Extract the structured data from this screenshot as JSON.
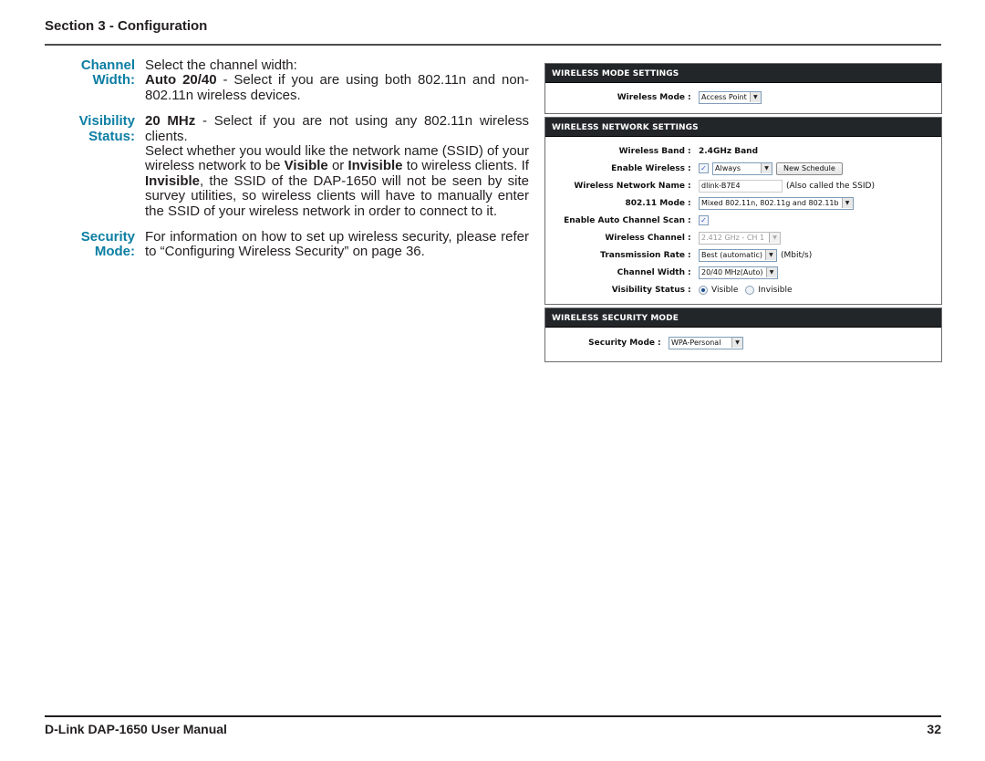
{
  "header": {
    "section_title": "Section 3 - Configuration"
  },
  "descriptions": [
    {
      "label_line1": "Channel",
      "label_line2": "Width:",
      "intro": "Select the channel width:",
      "bold1": "Auto 20/40",
      "text1": " - Select if you are using both 802.11n and non-802.11n wireless devices.",
      "bold2": "20 MHz",
      "text2": " - Select if you are not using any 802.11n wireless clients."
    },
    {
      "label_line1": "Visibility",
      "label_line2": "Status:",
      "text_a": "Select whether you would like the network name (SSID) of your wireless network to be ",
      "bold_a": "Visible",
      "text_b": " or ",
      "bold_b": "Invisible",
      "text_c": " to wireless clients. If ",
      "bold_c": "Invisible",
      "text_d": ", the SSID of the DAP-1650 will not be seen by site survey utilities, so wireless clients will have to manually enter the SSID of your wireless network in order to connect to it."
    },
    {
      "label_line1": "Security",
      "label_line2": "Mode:",
      "text": "For information on how to set up wireless security, please refer to “Configuring Wireless Security” on page 36."
    }
  ],
  "panels": {
    "mode": {
      "title": "WIRELESS MODE SETTINGS",
      "wireless_mode_label": "Wireless Mode",
      "wireless_mode_value": "Access Point"
    },
    "network": {
      "title": "WIRELESS NETWORK SETTINGS",
      "band_label": "Wireless Band",
      "band_value": "2.4GHz Band",
      "enable_label": "Enable Wireless",
      "enable_checked": true,
      "schedule_value": "Always",
      "new_schedule_button": "New Schedule",
      "ssid_label": "Wireless Network Name",
      "ssid_value": "dlink-B7E4",
      "ssid_note": "(Also called the SSID)",
      "mode_label": "802.11 Mode",
      "mode_value": "Mixed 802.11n, 802.11g and 802.11b",
      "auto_scan_label": "Enable Auto Channel Scan",
      "auto_scan_checked": true,
      "channel_label": "Wireless Channel",
      "channel_value": "2.412 GHz - CH 1",
      "rate_label": "Transmission Rate",
      "rate_value": "Best (automatic)",
      "rate_unit": "(Mbit/s)",
      "width_label": "Channel Width",
      "width_value": "20/40 MHz(Auto)",
      "visibility_label": "Visibility Status",
      "visible_label": "Visible",
      "invisible_label": "Invisible",
      "visibility_selected": "Visible"
    },
    "security": {
      "title": "WIRELESS SECURITY MODE",
      "security_label": "Security Mode",
      "security_value": "WPA-Personal"
    },
    "colon": ":"
  },
  "footer": {
    "manual_title": "D-Link DAP-1650 User Manual",
    "page_number": "32"
  },
  "colors": {
    "label_accent": "#0c7ea3",
    "panel_header_bg": "#222628"
  }
}
